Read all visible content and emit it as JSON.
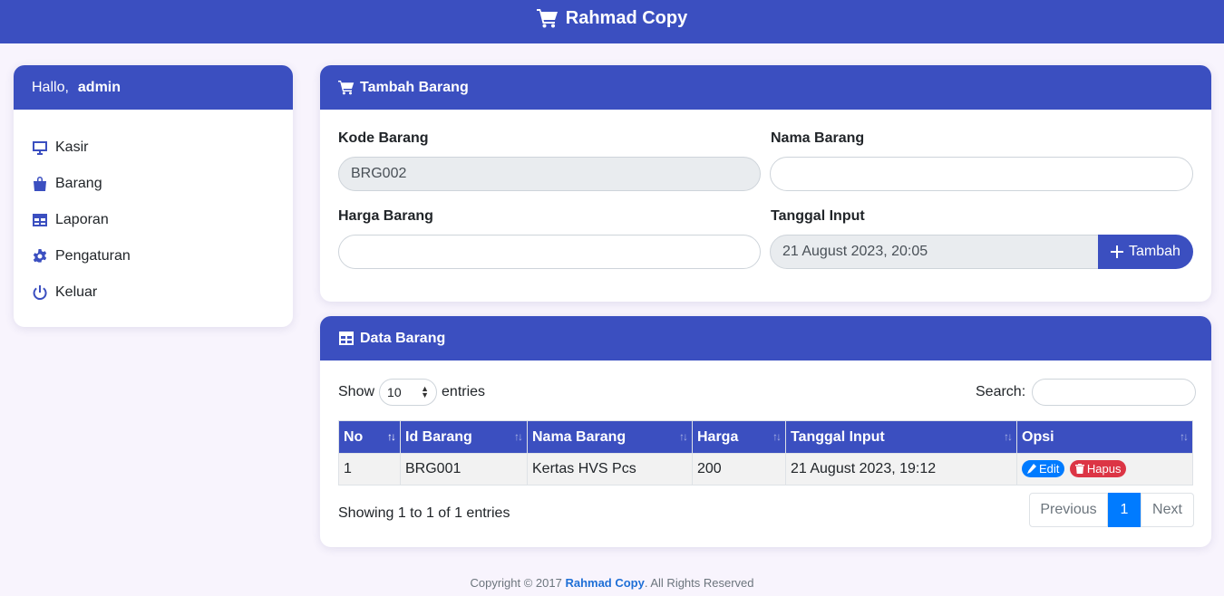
{
  "app": {
    "title": "Rahmad Copy"
  },
  "sidebar": {
    "greeting": "Hallo,",
    "user": "admin",
    "items": [
      {
        "label": "Kasir",
        "icon": "monitor-icon"
      },
      {
        "label": "Barang",
        "icon": "shopping-bag-icon"
      },
      {
        "label": "Laporan",
        "icon": "table-icon"
      },
      {
        "label": "Pengaturan",
        "icon": "gear-icon"
      },
      {
        "label": "Keluar",
        "icon": "power-icon"
      }
    ]
  },
  "form": {
    "title": "Tambah Barang",
    "kode_label": "Kode Barang",
    "kode_value": "BRG002",
    "nama_label": "Nama Barang",
    "nama_value": "",
    "harga_label": "Harga Barang",
    "harga_value": "",
    "tanggal_label": "Tanggal Input",
    "tanggal_value": "21 August 2023, 20:05",
    "submit_label": "Tambah"
  },
  "data": {
    "title": "Data Barang",
    "show_label": "Show",
    "entries_value": "10",
    "entries_label": "entries",
    "search_label": "Search:",
    "columns": [
      "No",
      "Id Barang",
      "Nama Barang",
      "Harga",
      "Tanggal Input",
      "Opsi"
    ],
    "rows": [
      {
        "no": "1",
        "id": "BRG001",
        "nama": "Kertas HVS Pcs",
        "harga": "200",
        "tanggal": "21 August 2023, 19:12"
      }
    ],
    "edit_label": "Edit",
    "delete_label": "Hapus",
    "info": "Showing 1 to 1 of 1 entries",
    "pager": {
      "prev": "Previous",
      "current": "1",
      "next": "Next"
    }
  },
  "footer": {
    "prefix": "Copyright © 2017",
    "brand": "Rahmad Copy",
    "suffix": ". All Rights Reserved"
  },
  "colors": {
    "primary": "#3b4fc0",
    "link": "#007bff",
    "danger": "#dc3545",
    "background": "#f8f4fd"
  }
}
